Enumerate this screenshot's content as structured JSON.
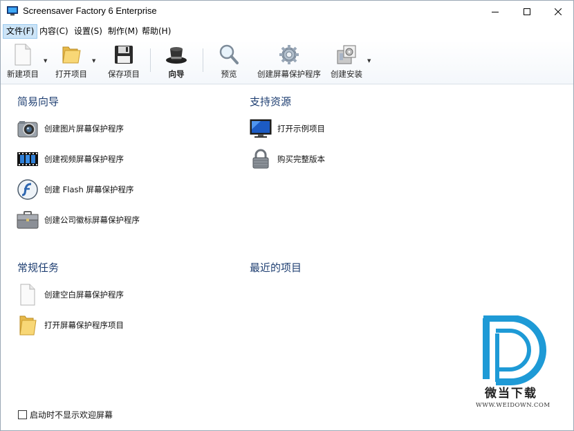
{
  "window": {
    "title": "Screensaver Factory 6 Enterprise"
  },
  "menu": [
    {
      "label": "文件(F)",
      "active": true
    },
    {
      "label": "内容(C)"
    },
    {
      "label": "设置(S)"
    },
    {
      "label": "制作(M)"
    },
    {
      "label": "帮助(H)"
    }
  ],
  "toolbar": {
    "new_project": "新建项目",
    "open_project": "打开项目",
    "save_project": "保存项目",
    "wizard": "向导",
    "preview": "预览",
    "build_screensaver": "创建屏幕保护程序",
    "build_installer": "创建安装"
  },
  "easy_wizard": {
    "title": "简易向导",
    "items": [
      {
        "label": "创建图片屏幕保护程序",
        "icon": "camera-icon"
      },
      {
        "label": "创建视频屏幕保护程序",
        "icon": "film-icon"
      },
      {
        "label": "创建 Flash 屏幕保护程序",
        "icon": "flash-icon"
      },
      {
        "label": "创建公司徽标屏幕保护程序",
        "icon": "briefcase-icon"
      }
    ]
  },
  "support": {
    "title": "支持资源",
    "items": [
      {
        "label": "打开示例项目",
        "icon": "monitor-icon"
      },
      {
        "label": "购买完整版本",
        "icon": "padlock-icon"
      }
    ]
  },
  "common_tasks": {
    "title": "常规任务",
    "items": [
      {
        "label": "创建空白屏幕保护程序",
        "icon": "blank-page-icon"
      },
      {
        "label": "打开屏幕保护程序项目",
        "icon": "folder-icon"
      }
    ]
  },
  "recent": {
    "title": "最近的项目"
  },
  "startup_checkbox": {
    "label": "启动时不显示欢迎屏幕",
    "checked": false
  },
  "watermark": {
    "text": "微当下载",
    "url": "WWW.WEIDOWN.COM"
  },
  "colors": {
    "section_title": "#1f3f72",
    "menu_active_bg": "#cce4f7",
    "watermark_blue": "#1e9ad6"
  }
}
